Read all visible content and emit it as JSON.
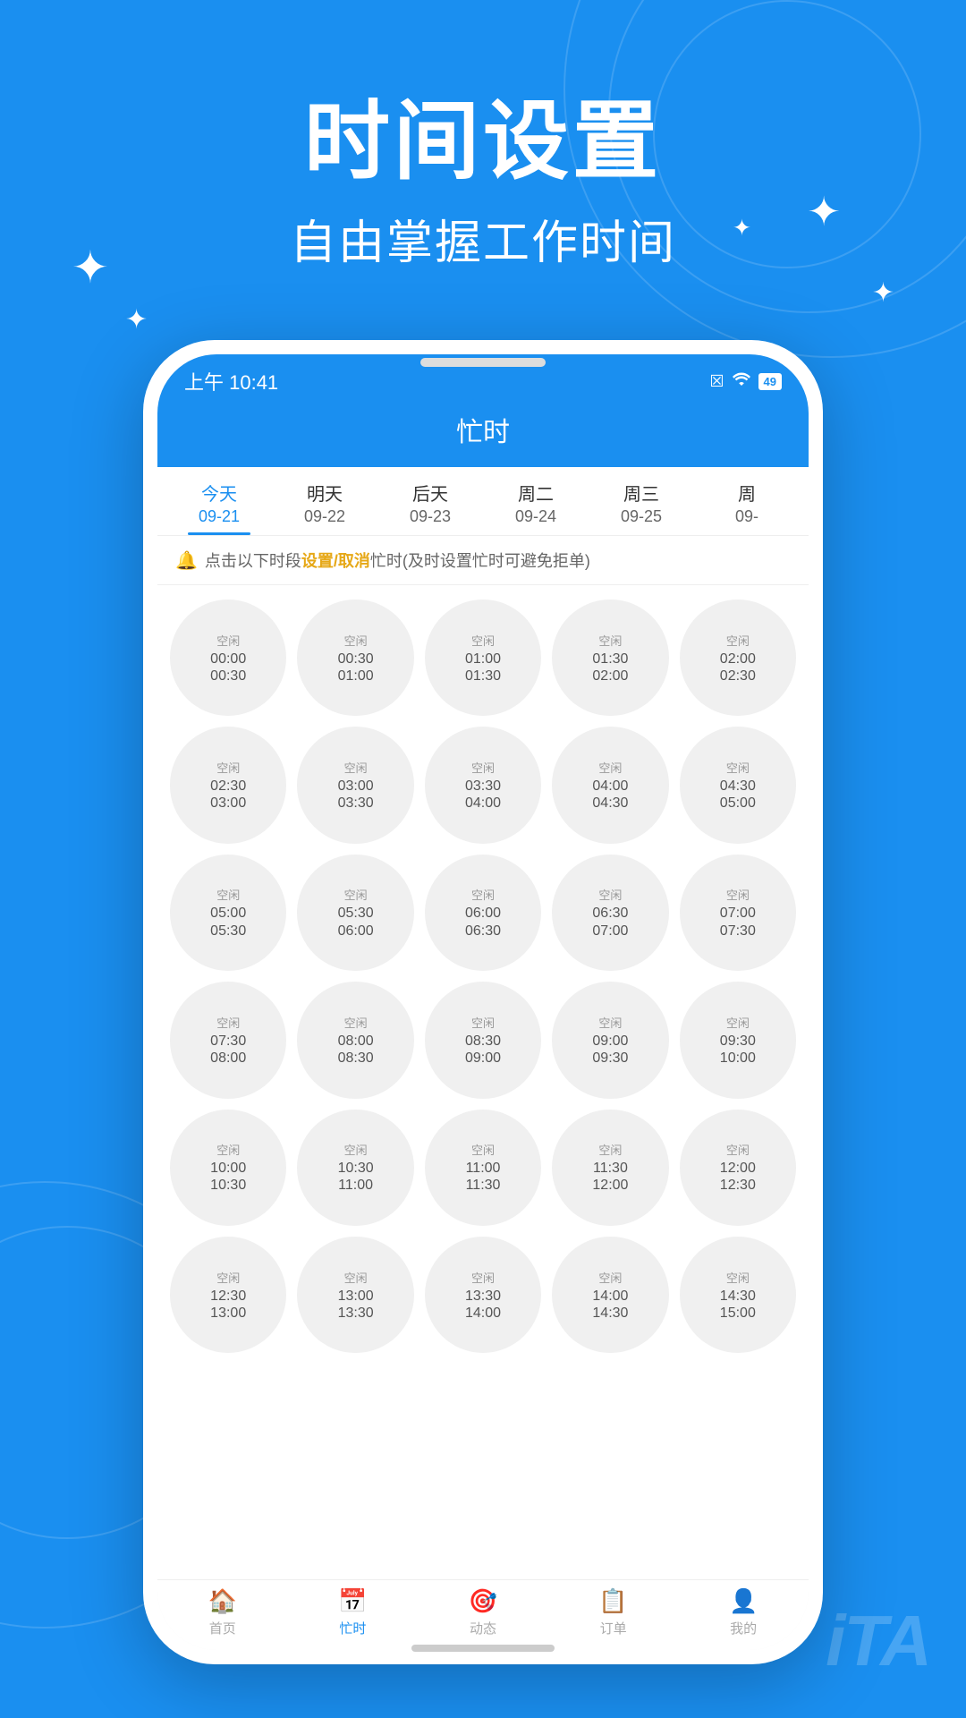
{
  "background": {
    "color": "#1a8ff0"
  },
  "header": {
    "title": "时间设置",
    "subtitle": "自由掌握工作时间"
  },
  "phone": {
    "statusBar": {
      "time": "上午 10:41",
      "icons": [
        "☒",
        "WiFi",
        "49"
      ]
    },
    "appTitle": "忙时",
    "notice": {
      "text": "点击以下时段",
      "highlight": "设置/取消",
      "suffix": "忙时(及时设置忙时可避免拒单)"
    },
    "days": [
      {
        "name": "今天",
        "date": "09-21",
        "active": true
      },
      {
        "name": "明天",
        "date": "09-22",
        "active": false
      },
      {
        "name": "后天",
        "date": "09-23",
        "active": false
      },
      {
        "name": "周二",
        "date": "09-24",
        "active": false
      },
      {
        "name": "周三",
        "date": "09-25",
        "active": false
      },
      {
        "name": "周",
        "date": "09-",
        "active": false
      }
    ],
    "timeSlots": [
      {
        "status": "空闲",
        "start": "00:00",
        "end": "00:30"
      },
      {
        "status": "空闲",
        "start": "00:30",
        "end": "01:00"
      },
      {
        "status": "空闲",
        "start": "01:00",
        "end": "01:30"
      },
      {
        "status": "空闲",
        "start": "01:30",
        "end": "02:00"
      },
      {
        "status": "空闲",
        "start": "02:00",
        "end": "02:30"
      },
      {
        "status": "空闲",
        "start": "02:30",
        "end": "03:00"
      },
      {
        "status": "空闲",
        "start": "03:00",
        "end": "03:30"
      },
      {
        "status": "空闲",
        "start": "03:30",
        "end": "04:00"
      },
      {
        "status": "空闲",
        "start": "04:00",
        "end": "04:30"
      },
      {
        "status": "空闲",
        "start": "04:30",
        "end": "05:00"
      },
      {
        "status": "空闲",
        "start": "05:00",
        "end": "05:30"
      },
      {
        "status": "空闲",
        "start": "05:30",
        "end": "06:00"
      },
      {
        "status": "空闲",
        "start": "06:00",
        "end": "06:30"
      },
      {
        "status": "空闲",
        "start": "06:30",
        "end": "07:00"
      },
      {
        "status": "空闲",
        "start": "07:00",
        "end": "07:30"
      },
      {
        "status": "空闲",
        "start": "07:30",
        "end": "08:00"
      },
      {
        "status": "空闲",
        "start": "08:00",
        "end": "08:30"
      },
      {
        "status": "空闲",
        "start": "08:30",
        "end": "09:00"
      },
      {
        "status": "空闲",
        "start": "09:00",
        "end": "09:30"
      },
      {
        "status": "空闲",
        "start": "09:30",
        "end": "10:00"
      },
      {
        "status": "空闲",
        "start": "10:00",
        "end": "10:30"
      },
      {
        "status": "空闲",
        "start": "10:30",
        "end": "11:00"
      },
      {
        "status": "空闲",
        "start": "11:00",
        "end": "11:30"
      },
      {
        "status": "空闲",
        "start": "11:30",
        "end": "12:00"
      },
      {
        "status": "空闲",
        "start": "12:00",
        "end": "12:30"
      },
      {
        "status": "空闲",
        "start": "12:30",
        "end": "13:00"
      },
      {
        "status": "空闲",
        "start": "13:00",
        "end": "13:30"
      },
      {
        "status": "空闲",
        "start": "13:30",
        "end": "14:00"
      },
      {
        "status": "空闲",
        "start": "14:00",
        "end": "14:30"
      },
      {
        "status": "空闲",
        "start": "14:30",
        "end": "15:00"
      }
    ],
    "bottomNav": [
      {
        "icon": "🏠",
        "label": "首页",
        "active": false
      },
      {
        "icon": "📅",
        "label": "忙时",
        "active": true
      },
      {
        "icon": "🎯",
        "label": "动态",
        "active": false
      },
      {
        "icon": "📋",
        "label": "订单",
        "active": false
      },
      {
        "icon": "👤",
        "label": "我的",
        "active": false
      }
    ]
  },
  "watermark": {
    "text": "iTA"
  }
}
